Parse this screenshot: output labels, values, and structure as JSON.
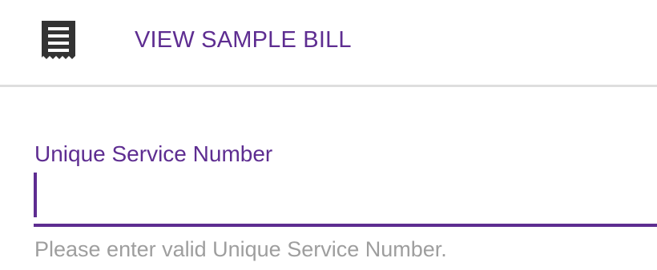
{
  "header": {
    "icon": "receipt-icon",
    "link_label": "VIEW SAMPLE BILL"
  },
  "form": {
    "field_label": "Unique Service Number",
    "field_value": "",
    "helper_text": "Please enter valid Unique Service Number."
  },
  "colors": {
    "accent": "#5e2d91",
    "helper": "#9e9e9e",
    "divider": "#dedede",
    "icon": "#333333"
  }
}
